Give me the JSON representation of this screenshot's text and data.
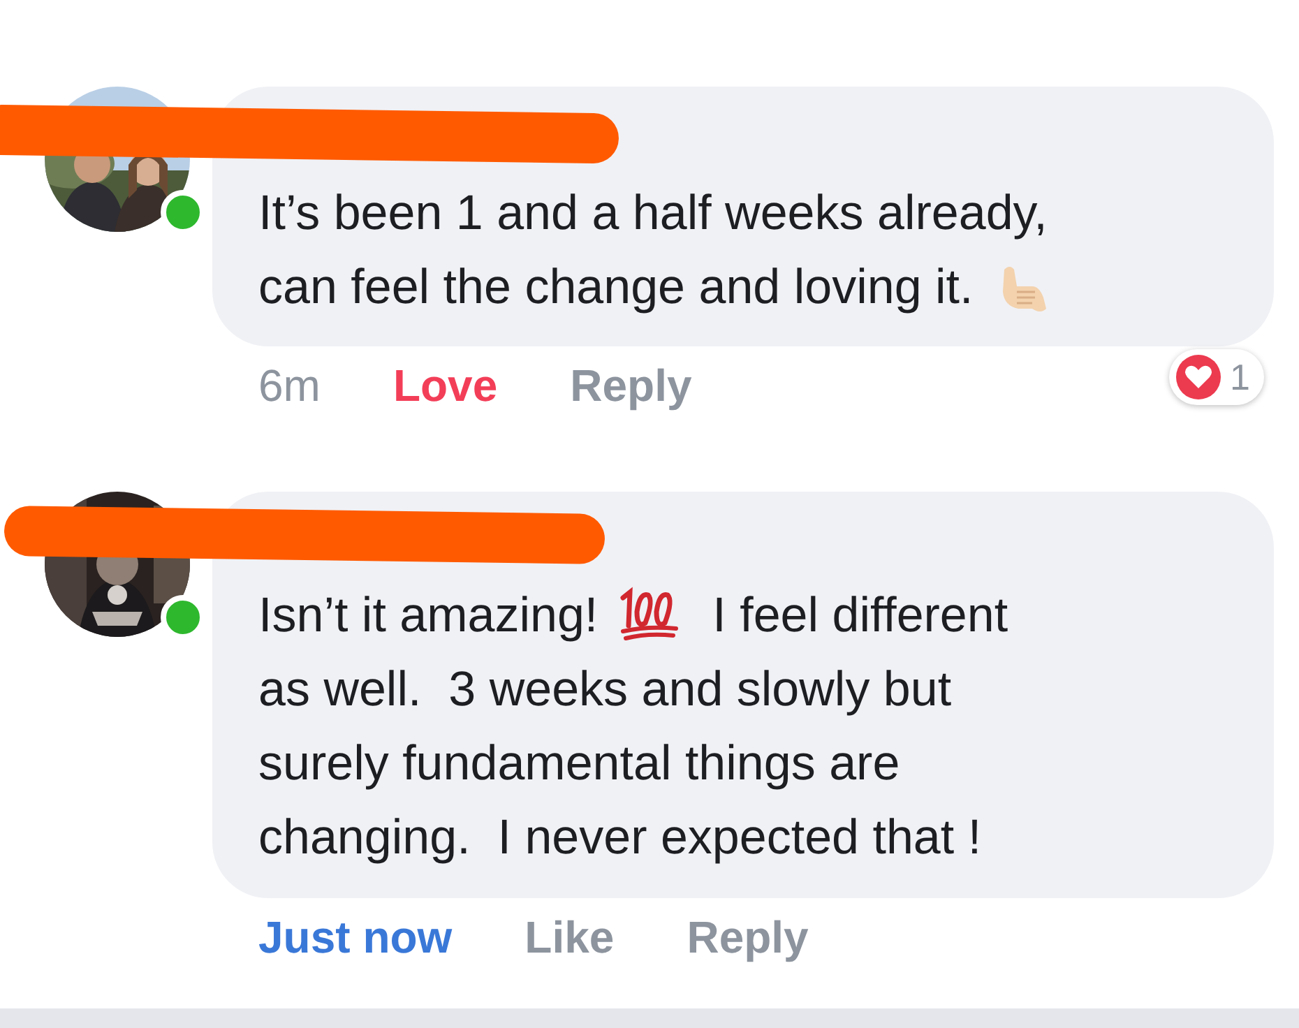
{
  "comments": [
    {
      "online": true,
      "lines": [
        [
          {
            "kind": "text",
            "text": "It’s been 1 and a half weeks already,"
          }
        ],
        [
          {
            "kind": "text",
            "text": "can feel the change and loving it."
          },
          {
            "kind": "shaka"
          }
        ]
      ],
      "time": "6m",
      "time_recent": false,
      "actions": [
        {
          "label": "Love",
          "reacted": true
        },
        {
          "label": "Reply",
          "reacted": false
        }
      ],
      "reaction": {
        "kind": "love",
        "count": "1"
      }
    },
    {
      "online": true,
      "lines": [
        [
          {
            "kind": "text",
            "text": "Isn’t it amazing!"
          },
          {
            "kind": "hundred"
          },
          {
            "kind": "text",
            "text": "I feel different"
          }
        ],
        [
          {
            "kind": "text",
            "text": "as well.  3 weeks and slowly but"
          }
        ],
        [
          {
            "kind": "text",
            "text": "surely fundamental things are"
          }
        ],
        [
          {
            "kind": "text",
            "text": "changing.  I never expected that !"
          }
        ]
      ],
      "time": "Just now",
      "time_recent": true,
      "actions": [
        {
          "label": "Like",
          "reacted": false
        },
        {
          "label": "Reply",
          "reacted": false
        }
      ]
    }
  ]
}
